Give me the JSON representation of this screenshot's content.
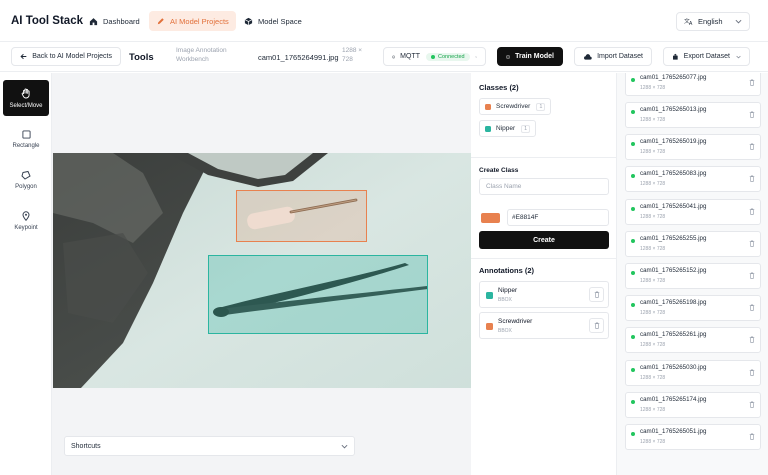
{
  "nav": {
    "brand": "AI Tool Stack",
    "items": [
      {
        "label": "Dashboard",
        "icon": "home-icon",
        "active": false
      },
      {
        "label": "AI Model Projects",
        "icon": "pen-icon",
        "active": true
      },
      {
        "label": "Model Space",
        "icon": "box-icon",
        "active": false
      }
    ],
    "language": "English"
  },
  "toolbar": {
    "back_label": "Back to AI Model Projects",
    "tools_title": "Tools",
    "subtitle": "Image Annotation Workbench",
    "filename": "cam01_1765264991.jpg",
    "dims": "1288 × 728",
    "mqtt_label": "MQTT",
    "mqtt_status": "Connected",
    "train_label": "Train Model",
    "import_label": "Import Dataset",
    "export_label": "Export Dataset"
  },
  "tools": [
    {
      "label": "Select/Move",
      "icon": "hand-icon",
      "active": true
    },
    {
      "label": "Rectangle",
      "icon": "square-icon",
      "active": false
    },
    {
      "label": "Polygon",
      "icon": "polygon-icon",
      "active": false
    },
    {
      "label": "Keypoint",
      "icon": "pin-icon",
      "active": false
    }
  ],
  "canvas": {
    "shortcuts_label": "Shortcuts"
  },
  "classes": {
    "title": "Classes (2)",
    "items": [
      {
        "name": "Screwdriver",
        "count": "1",
        "color": "#E8814F"
      },
      {
        "name": "Nipper",
        "count": "1",
        "color": "#2BB5A0"
      }
    ]
  },
  "create_class": {
    "title": "Create Class",
    "name_placeholder": "Class Name",
    "color_value": "#E8814F",
    "create_label": "Create"
  },
  "annotations": {
    "title": "Annotations (2)",
    "items": [
      {
        "name": "Nipper",
        "type": "BBOX",
        "color": "#2BB5A0"
      },
      {
        "name": "Screwdriver",
        "type": "BBOX",
        "color": "#E8814F"
      }
    ]
  },
  "files": [
    {
      "name": "cam01_1765265077.jpg",
      "dims": "1288 × 728"
    },
    {
      "name": "cam01_1765265013.jpg",
      "dims": "1288 × 728"
    },
    {
      "name": "cam01_1765265019.jpg",
      "dims": "1288 × 728"
    },
    {
      "name": "cam01_1765265083.jpg",
      "dims": "1288 × 728"
    },
    {
      "name": "cam01_1765265041.jpg",
      "dims": "1288 × 728"
    },
    {
      "name": "cam01_1765265255.jpg",
      "dims": "1288 × 728"
    },
    {
      "name": "cam01_1765265152.jpg",
      "dims": "1288 × 728"
    },
    {
      "name": "cam01_1765265198.jpg",
      "dims": "1288 × 728"
    },
    {
      "name": "cam01_1765265261.jpg",
      "dims": "1288 × 728"
    },
    {
      "name": "cam01_1765265030.jpg",
      "dims": "1288 × 728"
    },
    {
      "name": "cam01_1765265174.jpg",
      "dims": "1288 × 728"
    },
    {
      "name": "cam01_1765265051.jpg",
      "dims": "1288 × 728"
    }
  ]
}
